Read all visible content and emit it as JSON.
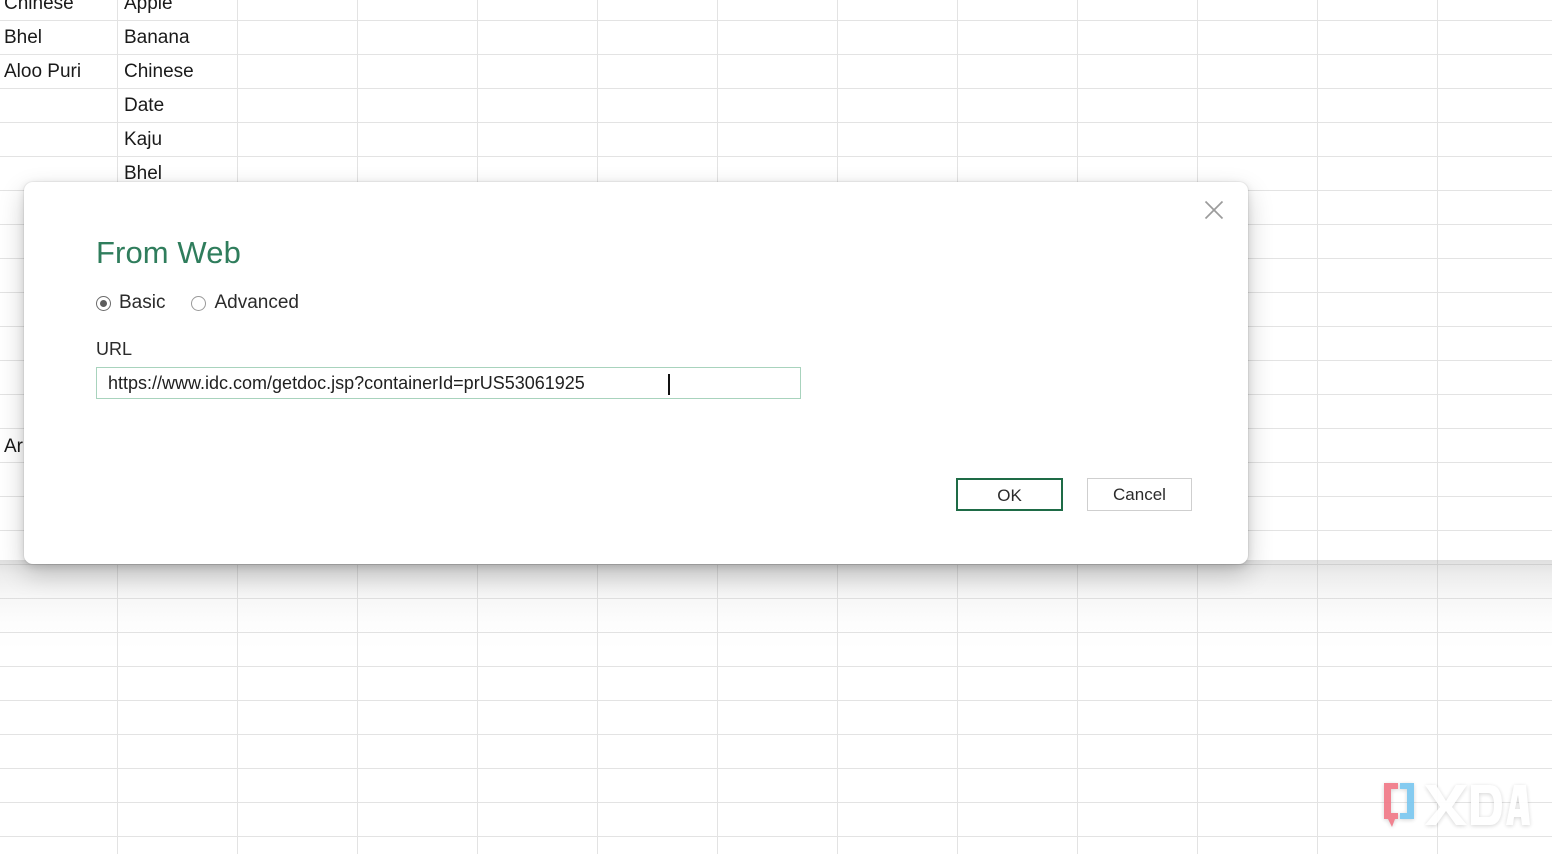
{
  "spreadsheet": {
    "column_a": [
      "Chinese",
      "Bhel",
      "Aloo Puri"
    ],
    "column_b": [
      "Apple",
      "Banana",
      "Chinese",
      "Date",
      "Kaju",
      "Bhel"
    ],
    "partial_cell": "Ar"
  },
  "dialog": {
    "title": "From Web",
    "close_icon": "close-icon",
    "mode": {
      "selected": "Basic",
      "options": [
        {
          "label": "Basic",
          "checked": true
        },
        {
          "label": "Advanced",
          "checked": false
        }
      ]
    },
    "url_field": {
      "label": "URL",
      "value": "https://www.idc.com/getdoc.jsp?containerId=prUS53061925",
      "placeholder": "Enter a URL",
      "border_color": "#a8d3bd",
      "has_caret": true
    },
    "buttons": {
      "ok_label": "OK",
      "cancel_label": "Cancel"
    },
    "accent_color": "#2f7d5c",
    "primary_border_color": "#1e6b46"
  },
  "watermark": {
    "text": "XDA",
    "bracket_color": "#f07a88",
    "accent_color": "#6ec6f0",
    "letter_color": "#ffffff"
  }
}
